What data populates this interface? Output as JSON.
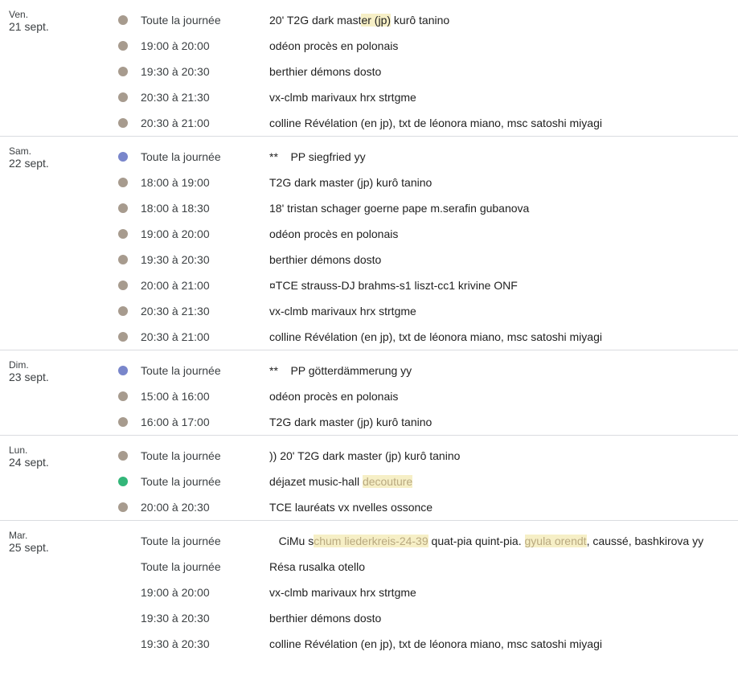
{
  "colors": {
    "taupe": "#a79b8e",
    "lavender": "#7986cb",
    "green": "#33b679",
    "highlight": "#f6efc6"
  },
  "days": [
    {
      "dow": "Ven.",
      "date": "21 sept.",
      "events": [
        {
          "time": "Toute la journée",
          "color": "taupe",
          "title": [
            "20' T2G dark mast",
            {
              "t": "er (jp)",
              "hl": true
            },
            " kurô tanino"
          ]
        },
        {
          "time": "19:00 à 20:00",
          "color": "taupe",
          "title": [
            "odéon procès en polonais"
          ]
        },
        {
          "time": "19:30 à 20:30",
          "color": "taupe",
          "title": [
            "berthier démons dosto"
          ]
        },
        {
          "time": "20:30 à 21:30",
          "color": "taupe",
          "title": [
            "vx-clmb marivaux hrx strtgme"
          ]
        },
        {
          "time": "20:30 à 21:00",
          "color": "taupe",
          "title": [
            "colline Révélation (en jp), txt de léonora miano, msc satoshi miyagi"
          ]
        }
      ]
    },
    {
      "dow": "Sam.",
      "date": "22 sept.",
      "events": [
        {
          "time": "Toute la journée",
          "color": "lavender",
          "title": [
            "**    PP siegfried yy"
          ]
        },
        {
          "time": "18:00 à 19:00",
          "color": "taupe",
          "title": [
            "T2G dark master (jp) kurô tanino"
          ]
        },
        {
          "time": "18:00 à 18:30",
          "color": "taupe",
          "title": [
            "18' tristan schager goerne pape m.serafin gubanova"
          ]
        },
        {
          "time": "19:00 à 20:00",
          "color": "taupe",
          "title": [
            "odéon procès en polonais"
          ]
        },
        {
          "time": "19:30 à 20:30",
          "color": "taupe",
          "title": [
            "berthier démons dosto"
          ]
        },
        {
          "time": "20:00 à 21:00",
          "color": "taupe",
          "title": [
            "¤TCE strauss-DJ brahms-s1 liszt-cc1 krivine ONF"
          ]
        },
        {
          "time": "20:30 à 21:30",
          "color": "taupe",
          "title": [
            "vx-clmb marivaux hrx strtgme"
          ]
        },
        {
          "time": "20:30 à 21:00",
          "color": "taupe",
          "title": [
            "colline Révélation (en jp), txt de léonora miano, msc satoshi miyagi"
          ]
        }
      ]
    },
    {
      "dow": "Dim.",
      "date": "23 sept.",
      "events": [
        {
          "time": "Toute la journée",
          "color": "lavender",
          "title": [
            "**    PP götterdämmerung yy"
          ]
        },
        {
          "time": "15:00 à 16:00",
          "color": "taupe",
          "title": [
            "odéon procès en polonais"
          ]
        },
        {
          "time": "16:00 à 17:00",
          "color": "taupe",
          "title": [
            "T2G dark master (jp) kurô tanino"
          ]
        }
      ]
    },
    {
      "dow": "Lun.",
      "date": "24 sept.",
      "events": [
        {
          "time": "Toute la journée",
          "color": "taupe",
          "title": [
            ")) 20' T2G dark master (jp) kurô tanino"
          ]
        },
        {
          "time": "Toute la journée",
          "color": "green",
          "title": [
            "déjazet music-hall ",
            {
              "t": "decouture",
              "hl": true,
              "faded": true
            }
          ]
        },
        {
          "time": "20:00 à 20:30",
          "color": "taupe",
          "title": [
            "TCE lauréats vx nvelles ossonce"
          ]
        }
      ]
    },
    {
      "dow": "Mar.",
      "date": "25 sept.",
      "events": [
        {
          "time": "Toute la journée",
          "color": "",
          "title": [
            "   CiMu s",
            {
              "t": "chum liederkreis-24-39",
              "hl": true,
              "faded": true
            },
            " quat-pia quint-pia. ",
            {
              "t": "gyula orendt",
              "hl": true,
              "faded": true
            },
            ", caussé, bashkirova yy"
          ]
        },
        {
          "time": "Toute la journée",
          "color": "",
          "title": [
            "Résa rusalka otello"
          ]
        },
        {
          "time": "19:00 à 20:00",
          "color": "",
          "title": [
            "vx-clmb marivaux hrx strtgme"
          ]
        },
        {
          "time": "19:30 à 20:30",
          "color": "",
          "title": [
            "berthier démons dosto"
          ]
        },
        {
          "time": "19:30 à 20:30",
          "color": "",
          "title": [
            "colline Révélation (en jp), txt de léonora miano, msc satoshi miyagi"
          ]
        }
      ]
    }
  ]
}
